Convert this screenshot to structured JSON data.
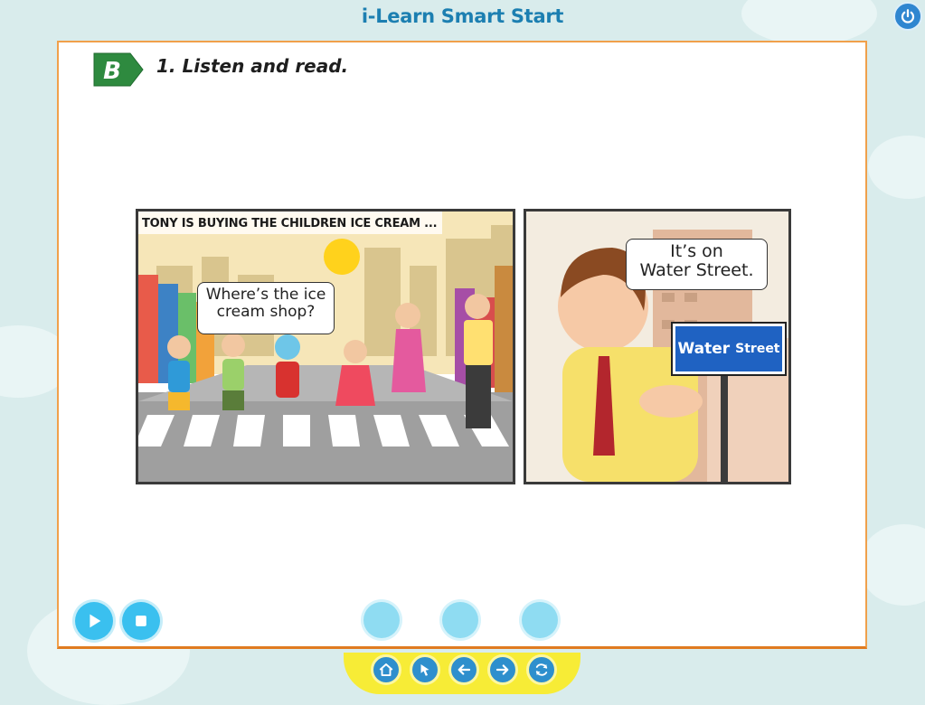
{
  "app": {
    "title": "i-Learn Smart Start"
  },
  "section": {
    "badge": "B",
    "heading": "1. Listen and read."
  },
  "comic": {
    "panel1": {
      "caption": "TONY IS BUYING THE CHILDREN ICE CREAM ...",
      "bubble_line1": "Where’s the ice",
      "bubble_line2": "cream shop?"
    },
    "panel2": {
      "bubble_line1": "It’s on",
      "bubble_line2": "Water Street.",
      "sign_word1": "Water",
      "sign_word2": "Street"
    }
  },
  "icons": {
    "power": "power-icon",
    "play": "play-icon",
    "stop": "stop-icon",
    "home": "home-icon",
    "cursor": "cursor-icon",
    "back": "arrow-left-icon",
    "next": "arrow-right-icon",
    "refresh": "refresh-icon"
  },
  "colors": {
    "accent": "#3ac0ef",
    "panel_border": "#f0a04b",
    "title": "#1c7fb1",
    "nav_bar": "#f7ec36",
    "badge": "#2e8a3f"
  }
}
